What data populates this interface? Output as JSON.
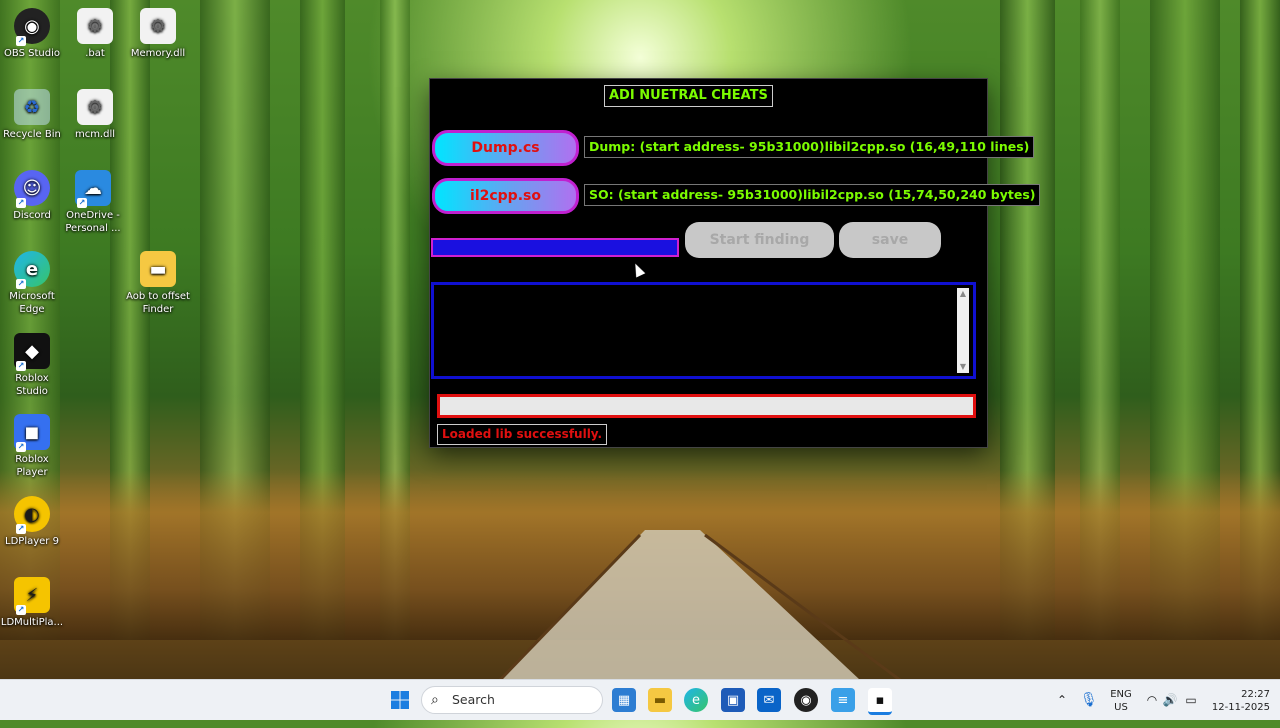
{
  "desktop": {
    "icons": [
      {
        "label": "OBS Studio"
      },
      {
        "label": ".bat"
      },
      {
        "label": "Memory.dll"
      },
      {
        "label": "Recycle Bin"
      },
      {
        "label": "mcm.dll"
      },
      {
        "label": "Discord"
      },
      {
        "label": "OneDrive - Personal ..."
      },
      {
        "label": "Microsoft Edge"
      },
      {
        "label": "Aob to offset Finder"
      },
      {
        "label": "Roblox Studio"
      },
      {
        "label": "Roblox Player"
      },
      {
        "label": "LDPlayer 9"
      },
      {
        "label": "LDMultiPla..."
      }
    ]
  },
  "app": {
    "title": "ADI NUETRAL CHEATS",
    "dump_button": "Dump.cs",
    "il2cpp_button": "il2cpp.so",
    "dump_info": "Dump: (start address- 95b31000)libil2cpp.so (16,49,110 lines)",
    "so_info": "SO: (start address- 95b31000)libil2cpp.so (15,74,50,240 bytes)",
    "search_value": "",
    "start_button": "Start finding",
    "save_button": "save",
    "output_text": "",
    "progress": 0,
    "status": "Loaded lib successfully."
  },
  "taskbar": {
    "search_placeholder": "Search",
    "lang_top": "ENG",
    "lang_bottom": "US",
    "time": "22:27",
    "date": "12-11-2025"
  },
  "colors": {
    "accent_green": "#7cfc00",
    "accent_red": "#e01010",
    "accent_blue": "#1010d0",
    "accent_magenta": "#c020d0"
  }
}
